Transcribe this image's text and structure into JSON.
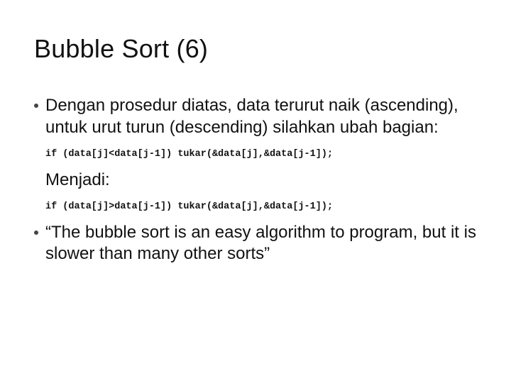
{
  "slide": {
    "title": "Bubble Sort (6)",
    "bullets": [
      {
        "text": "Dengan prosedur diatas,  data terurut naik (ascending),  untuk  urut turun (descending) silahkan ubah bagian:",
        "code_after": "if (data[j]<data[j-1]) tukar(&data[j],&data[j-1]);",
        "sub_after": "Menjadi:",
        "code_after2": "if (data[j]>data[j-1]) tukar(&data[j],&data[j-1]);"
      },
      {
        "text": "“The bubble sort is an easy algorithm to program, but it is slower than many other sorts”"
      }
    ]
  }
}
